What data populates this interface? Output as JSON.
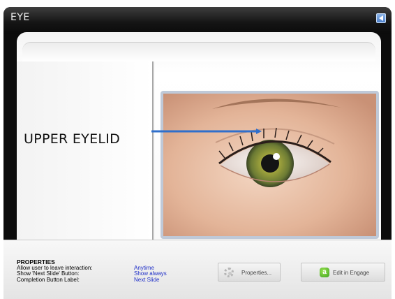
{
  "window": {
    "title": "EYE"
  },
  "slide": {
    "label": "UPPER EYELID",
    "image_alt": "eye-closeup"
  },
  "properties": {
    "heading": "PROPERTIES",
    "rows": [
      {
        "key": "Allow user to leave interaction:",
        "value": "Anytime"
      },
      {
        "key": "Show 'Next Slide' Button:",
        "value": "Show always"
      },
      {
        "key": "Completion Button Label:",
        "value": "Next Slide"
      }
    ]
  },
  "buttons": {
    "properties_label": "Properties...",
    "engage_label": "Edit in Engage"
  },
  "colors": {
    "accent_blue": "#2f6fcc",
    "value_blue": "#1f2fc8",
    "engage_green": "#3ea11f"
  }
}
